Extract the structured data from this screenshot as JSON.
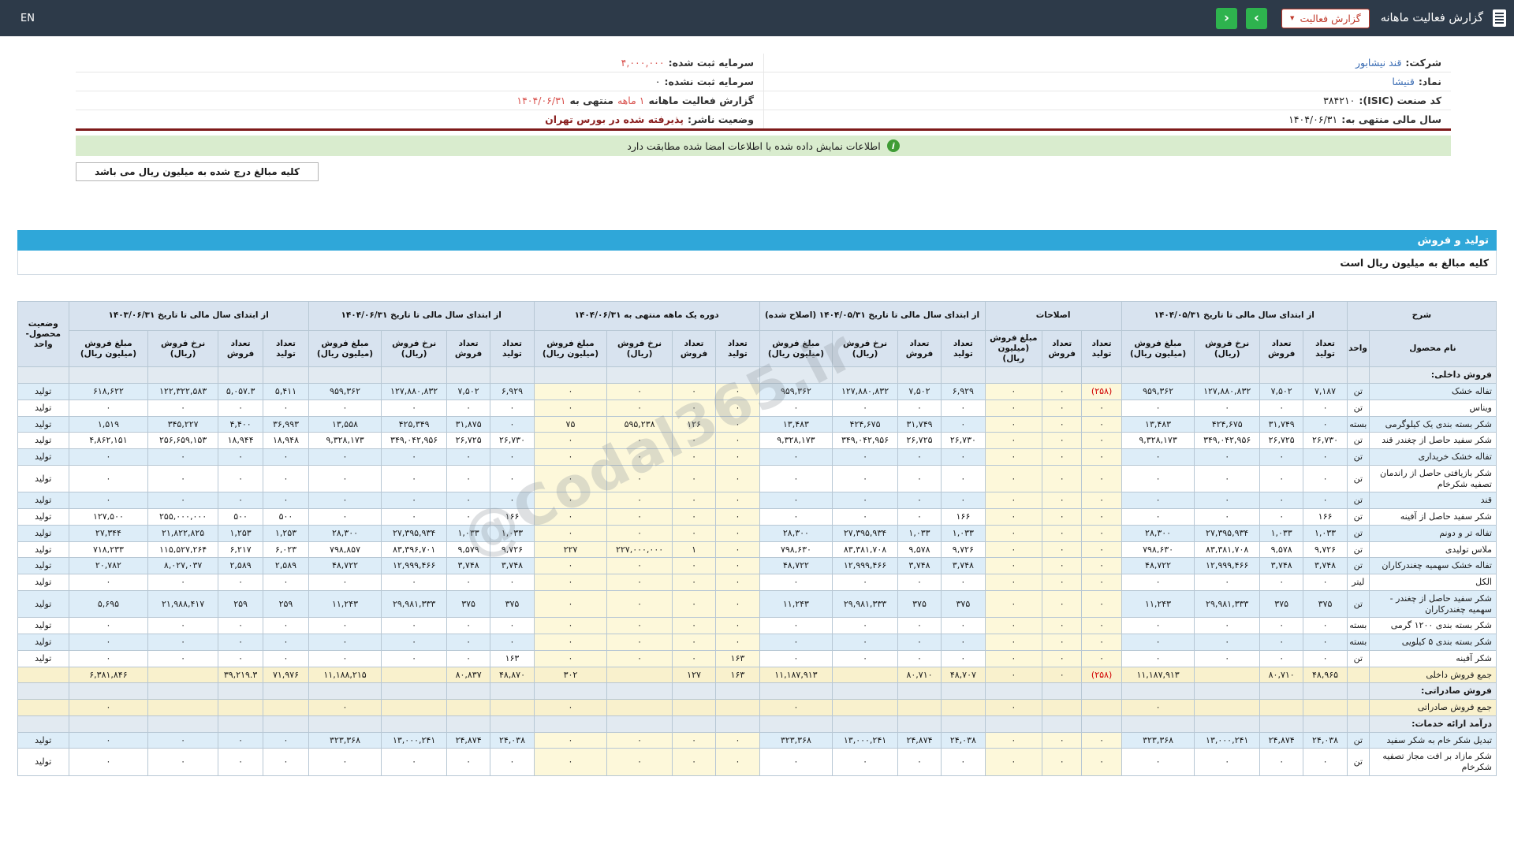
{
  "topbar": {
    "title": "گزارش فعالیت ماهانه",
    "report_button": {
      "label": "گزارش فعالیت",
      "caret": "▼"
    },
    "nav": {
      "forward": "›",
      "back": "‹"
    },
    "lang": "EN"
  },
  "company_info": {
    "right": [
      {
        "parts": [
          {
            "t": "شرکت:",
            "s": "label"
          },
          {
            "t": "قند نیشابور",
            "s": "link"
          }
        ]
      },
      {
        "parts": [
          {
            "t": "نماد:",
            "s": "label"
          },
          {
            "t": "قنیشا",
            "s": "link"
          }
        ]
      },
      {
        "parts": [
          {
            "t": "کد صنعت (ISIC):",
            "s": "label"
          },
          {
            "t": "۳۸۴۲۱۰",
            "s": "plain"
          }
        ]
      },
      {
        "parts": [
          {
            "t": "سال مالی منتهی به:",
            "s": "label"
          },
          {
            "t": "۱۴۰۴/۰۶/۳۱",
            "s": "plain"
          }
        ]
      }
    ],
    "left": [
      {
        "parts": [
          {
            "t": "سرمایه ثبت شده:",
            "s": "label"
          },
          {
            "t": "۴,۰۰۰,۰۰۰",
            "s": "red"
          }
        ]
      },
      {
        "parts": [
          {
            "t": "سرمایه ثبت نشده:",
            "s": "label"
          },
          {
            "t": "۰",
            "s": "plain"
          }
        ]
      },
      {
        "parts": [
          {
            "t": "گزارش فعالیت ماهانه",
            "s": "label"
          },
          {
            "t": "۱ ماهه",
            "s": "red"
          },
          {
            "t": "منتهی به",
            "s": "label"
          },
          {
            "t": "۱۴۰۴/۰۶/۳۱",
            "s": "red"
          }
        ]
      },
      {
        "parts": [
          {
            "t": "وضعیت ناشر:",
            "s": "label"
          },
          {
            "t": "پذیرفته شده در بورس تهران",
            "s": "darkred"
          }
        ]
      }
    ]
  },
  "notice": {
    "text": "اطلاعات نمایش داده شده با اطلاعات امضا شده مطابقت دارد",
    "icon": "i"
  },
  "amounts_note": "کلیه مبالغ درج شده به میلیون ریال می باشد",
  "section_bar": "تولید و فروش",
  "table_note": "کلیه مبالغ به میلیون ریال است",
  "watermark": "@Codal365.ir",
  "table": {
    "columns": {
      "desc": "شرح",
      "name": "نام محصول",
      "unit": "واحد",
      "qty_prod": "تعداد تولید",
      "qty_sale": "تعداد فروش",
      "rate": "نرخ فروش (ریال)",
      "amount": "مبلغ فروش (میلیون ریال)",
      "status_l1": "وضعیت",
      "status_l2": "محصول-واحد"
    },
    "groups": [
      {
        "label": "از ابتدای سال مالی تا تاریخ ۱۴۰۴/۰۵/۳۱",
        "cols": [
          "qty_prod",
          "qty_sale",
          "rate",
          "amount"
        ],
        "hl": false
      },
      {
        "label": "اصلاحات",
        "cols": [
          "qty_prod",
          "qty_sale",
          "amount"
        ],
        "hl": true
      },
      {
        "label": "از ابتدای سال مالی تا تاریخ ۱۴۰۴/۰۵/۳۱ (اصلاح شده)",
        "cols": [
          "qty_prod",
          "qty_sale",
          "rate",
          "amount"
        ],
        "hl": false
      },
      {
        "label": "دوره یک ماهه منتهی به ۱۴۰۴/۰۶/۳۱",
        "cols": [
          "qty_prod",
          "qty_sale",
          "rate",
          "amount"
        ],
        "hl": true
      },
      {
        "label": "از ابتدای سال مالی تا تاریخ ۱۴۰۴/۰۶/۳۱",
        "cols": [
          "qty_prod",
          "qty_sale",
          "rate",
          "amount"
        ],
        "hl": false
      },
      {
        "label": "از ابتدای سال مالی تا تاریخ ۱۴۰۳/۰۶/۳۱",
        "cols": [
          "qty_prod",
          "qty_sale",
          "rate",
          "amount"
        ],
        "hl": false
      }
    ],
    "rows": [
      {
        "type": "section",
        "name": "فروش داخلی:"
      },
      {
        "type": "product",
        "name": "تفاله خشک",
        "unit": "تن",
        "status": "تولید",
        "v": [
          [
            "۷,۱۸۷",
            "۷,۵۰۲",
            "۱۲۷,۸۸۰,۸۳۲",
            "۹۵۹,۳۶۲"
          ],
          [
            "(۲۵۸)",
            "۰",
            "۰"
          ],
          [
            "۶,۹۲۹",
            "۷,۵۰۲",
            "۱۲۷,۸۸۰,۸۳۲",
            "۹۵۹,۳۶۲"
          ],
          [
            "۰",
            "۰",
            "۰",
            "۰"
          ],
          [
            "۶,۹۲۹",
            "۷,۵۰۲",
            "۱۲۷,۸۸۰,۸۳۲",
            "۹۵۹,۳۶۲"
          ],
          [
            "۵,۴۱۱",
            "۵,۰۵۷.۳",
            "۱۲۲,۳۲۲,۵۸۳",
            "۶۱۸,۶۲۲"
          ]
        ]
      },
      {
        "type": "product",
        "name": "ویناس",
        "unit": "تن",
        "status": "تولید",
        "v": [
          [
            "۰",
            "۰",
            "۰",
            "۰"
          ],
          [
            "۰",
            "۰",
            "۰"
          ],
          [
            "۰",
            "۰",
            "۰",
            "۰"
          ],
          [
            "۰",
            "۰",
            "۰",
            "۰"
          ],
          [
            "۰",
            "۰",
            "۰",
            "۰"
          ],
          [
            "۰",
            "۰",
            "۰",
            "۰"
          ]
        ]
      },
      {
        "type": "product",
        "name": "شکر بسته بندی یک کیلوگرمی",
        "unit": "بسته",
        "status": "تولید",
        "v": [
          [
            "۰",
            "۳۱,۷۴۹",
            "۴۲۴,۶۷۵",
            "۱۳,۴۸۳"
          ],
          [
            "۰",
            "۰",
            "۰"
          ],
          [
            "۰",
            "۳۱,۷۴۹",
            "۴۲۴,۶۷۵",
            "۱۳,۴۸۳"
          ],
          [
            "۰",
            "۱۲۶",
            "۵۹۵,۲۳۸",
            "۷۵"
          ],
          [
            "۰",
            "۳۱,۸۷۵",
            "۴۲۵,۳۴۹",
            "۱۳,۵۵۸"
          ],
          [
            "۳۶,۹۹۳",
            "۴,۴۰۰",
            "۳۴۵,۲۲۷",
            "۱,۵۱۹"
          ]
        ]
      },
      {
        "type": "product",
        "name": "شکر سفید حاصل از چغندر قند",
        "unit": "تن",
        "status": "تولید",
        "v": [
          [
            "۲۶,۷۳۰",
            "۲۶,۷۲۵",
            "۳۴۹,۰۴۲,۹۵۶",
            "۹,۳۲۸,۱۷۳"
          ],
          [
            "۰",
            "۰",
            "۰"
          ],
          [
            "۲۶,۷۳۰",
            "۲۶,۷۲۵",
            "۳۴۹,۰۴۲,۹۵۶",
            "۹,۳۲۸,۱۷۳"
          ],
          [
            "۰",
            "۰",
            "۰",
            "۰"
          ],
          [
            "۲۶,۷۳۰",
            "۲۶,۷۲۵",
            "۳۴۹,۰۴۲,۹۵۶",
            "۹,۳۲۸,۱۷۳"
          ],
          [
            "۱۸,۹۴۸",
            "۱۸,۹۴۴",
            "۲۵۶,۶۵۹,۱۵۳",
            "۴,۸۶۲,۱۵۱"
          ]
        ]
      },
      {
        "type": "product",
        "name": "تفاله خشک خریداری",
        "unit": "تن",
        "status": "تولید",
        "v": [
          [
            "۰",
            "۰",
            "۰",
            "۰"
          ],
          [
            "۰",
            "۰",
            "۰"
          ],
          [
            "۰",
            "۰",
            "۰",
            "۰"
          ],
          [
            "۰",
            "۰",
            "۰",
            "۰"
          ],
          [
            "۰",
            "۰",
            "۰",
            "۰"
          ],
          [
            "۰",
            "۰",
            "۰",
            "۰"
          ]
        ]
      },
      {
        "type": "product",
        "name": "شکر بازیافتی حاصل از راندمان تصفیه شکرخام",
        "unit": "تن",
        "status": "تولید",
        "v": [
          [
            "۰",
            "۰",
            "۰",
            "۰"
          ],
          [
            "۰",
            "۰",
            "۰"
          ],
          [
            "۰",
            "۰",
            "۰",
            "۰"
          ],
          [
            "۰",
            "۰",
            "۰",
            "۰"
          ],
          [
            "۰",
            "۰",
            "۰",
            "۰"
          ],
          [
            "۰",
            "۰",
            "۰",
            "۰"
          ]
        ]
      },
      {
        "type": "product",
        "name": "قند",
        "unit": "تن",
        "status": "تولید",
        "v": [
          [
            "۰",
            "۰",
            "۰",
            "۰"
          ],
          [
            "۰",
            "۰",
            "۰"
          ],
          [
            "۰",
            "۰",
            "۰",
            "۰"
          ],
          [
            "۰",
            "۰",
            "۰",
            "۰"
          ],
          [
            "۰",
            "۰",
            "۰",
            "۰"
          ],
          [
            "۰",
            "۰",
            "۰",
            "۰"
          ]
        ]
      },
      {
        "type": "product",
        "name": "شکر سفید حاصل از آفینه",
        "unit": "تن",
        "status": "تولید",
        "v": [
          [
            "۱۶۶",
            "۰",
            "۰",
            "۰"
          ],
          [
            "۰",
            "۰",
            "۰"
          ],
          [
            "۱۶۶",
            "۰",
            "۰",
            "۰"
          ],
          [
            "۰",
            "۰",
            "۰",
            "۰"
          ],
          [
            "۱۶۶",
            "۰",
            "۰",
            "۰"
          ],
          [
            "۵۰۰",
            "۵۰۰",
            "۲۵۵,۰۰۰,۰۰۰",
            "۱۲۷,۵۰۰"
          ]
        ]
      },
      {
        "type": "product",
        "name": "تفاله تر و دونم",
        "unit": "تن",
        "status": "تولید",
        "v": [
          [
            "۱,۰۳۳",
            "۱,۰۳۳",
            "۲۷,۳۹۵,۹۳۴",
            "۲۸,۳۰۰"
          ],
          [
            "۰",
            "۰",
            "۰"
          ],
          [
            "۱,۰۳۳",
            "۱,۰۳۳",
            "۲۷,۳۹۵,۹۳۴",
            "۲۸,۳۰۰"
          ],
          [
            "۰",
            "۰",
            "۰",
            "۰"
          ],
          [
            "۱,۰۳۳",
            "۱,۰۳۳",
            "۲۷,۳۹۵,۹۳۴",
            "۲۸,۳۰۰"
          ],
          [
            "۱,۲۵۳",
            "۱,۲۵۳",
            "۲۱,۸۲۲,۸۲۵",
            "۲۷,۳۴۴"
          ]
        ]
      },
      {
        "type": "product",
        "name": "ملاس تولیدی",
        "unit": "تن",
        "status": "تولید",
        "v": [
          [
            "۹,۷۲۶",
            "۹,۵۷۸",
            "۸۳,۳۸۱,۷۰۸",
            "۷۹۸,۶۳۰"
          ],
          [
            "۰",
            "۰",
            "۰"
          ],
          [
            "۹,۷۲۶",
            "۹,۵۷۸",
            "۸۳,۳۸۱,۷۰۸",
            "۷۹۸,۶۳۰"
          ],
          [
            "۰",
            "۱",
            "۲۲۷,۰۰۰,۰۰۰",
            "۲۲۷"
          ],
          [
            "۹,۷۲۶",
            "۹,۵۷۹",
            "۸۳,۳۹۶,۷۰۱",
            "۷۹۸,۸۵۷"
          ],
          [
            "۶,۰۲۳",
            "۶,۲۱۷",
            "۱۱۵,۵۲۷,۲۶۴",
            "۷۱۸,۲۳۳"
          ]
        ]
      },
      {
        "type": "product",
        "name": "تفاله خشک سهمیه چغندرکاران",
        "unit": "تن",
        "status": "تولید",
        "v": [
          [
            "۳,۷۴۸",
            "۳,۷۴۸",
            "۱۲,۹۹۹,۴۶۶",
            "۴۸,۷۲۲"
          ],
          [
            "۰",
            "۰",
            "۰"
          ],
          [
            "۳,۷۴۸",
            "۳,۷۴۸",
            "۱۲,۹۹۹,۴۶۶",
            "۴۸,۷۲۲"
          ],
          [
            "۰",
            "۰",
            "۰",
            "۰"
          ],
          [
            "۳,۷۴۸",
            "۳,۷۴۸",
            "۱۲,۹۹۹,۴۶۶",
            "۴۸,۷۲۲"
          ],
          [
            "۲,۵۸۹",
            "۲,۵۸۹",
            "۸,۰۲۷,۰۳۷",
            "۲۰,۷۸۲"
          ]
        ]
      },
      {
        "type": "product",
        "name": "الکل",
        "unit": "لیتر",
        "status": "تولید",
        "v": [
          [
            "۰",
            "۰",
            "۰",
            "۰"
          ],
          [
            "۰",
            "۰",
            "۰"
          ],
          [
            "۰",
            "۰",
            "۰",
            "۰"
          ],
          [
            "۰",
            "۰",
            "۰",
            "۰"
          ],
          [
            "۰",
            "۰",
            "۰",
            "۰"
          ],
          [
            "۰",
            "۰",
            "۰",
            "۰"
          ]
        ]
      },
      {
        "type": "product",
        "name": "شکر سفید حاصل از چغندر - سهمیه چغندرکاران",
        "unit": "تن",
        "status": "تولید",
        "v": [
          [
            "۳۷۵",
            "۳۷۵",
            "۲۹,۹۸۱,۳۳۳",
            "۱۱,۲۴۳"
          ],
          [
            "۰",
            "۰",
            "۰"
          ],
          [
            "۳۷۵",
            "۳۷۵",
            "۲۹,۹۸۱,۳۳۳",
            "۱۱,۲۴۳"
          ],
          [
            "۰",
            "۰",
            "۰",
            "۰"
          ],
          [
            "۳۷۵",
            "۳۷۵",
            "۲۹,۹۸۱,۳۳۳",
            "۱۱,۲۴۳"
          ],
          [
            "۲۵۹",
            "۲۵۹",
            "۲۱,۹۸۸,۴۱۷",
            "۵,۶۹۵"
          ]
        ]
      },
      {
        "type": "product",
        "name": "شکر بسته بندی ۱۲۰۰ گرمی",
        "unit": "بسته",
        "status": "تولید",
        "v": [
          [
            "۰",
            "۰",
            "۰",
            "۰"
          ],
          [
            "۰",
            "۰",
            "۰"
          ],
          [
            "۰",
            "۰",
            "۰",
            "۰"
          ],
          [
            "۰",
            "۰",
            "۰",
            "۰"
          ],
          [
            "۰",
            "۰",
            "۰",
            "۰"
          ],
          [
            "۰",
            "۰",
            "۰",
            "۰"
          ]
        ]
      },
      {
        "type": "product",
        "name": "شکر بسته بندی ۵ کیلویی",
        "unit": "بسته",
        "status": "تولید",
        "v": [
          [
            "۰",
            "۰",
            "۰",
            "۰"
          ],
          [
            "۰",
            "۰",
            "۰"
          ],
          [
            "۰",
            "۰",
            "۰",
            "۰"
          ],
          [
            "۰",
            "۰",
            "۰",
            "۰"
          ],
          [
            "۰",
            "۰",
            "۰",
            "۰"
          ],
          [
            "۰",
            "۰",
            "۰",
            "۰"
          ]
        ]
      },
      {
        "type": "product",
        "name": "شکر آفینه",
        "unit": "تن",
        "status": "تولید",
        "v": [
          [
            "۰",
            "۰",
            "۰",
            "۰"
          ],
          [
            "۰",
            "۰",
            "۰"
          ],
          [
            "۰",
            "۰",
            "۰",
            "۰"
          ],
          [
            "۱۶۳",
            "۰",
            "۰",
            "۰"
          ],
          [
            "۱۶۳",
            "۰",
            "۰",
            "۰"
          ],
          [
            "۰",
            "۰",
            "۰",
            "۰"
          ]
        ]
      },
      {
        "type": "total",
        "name": "جمع فروش داخلی",
        "unit": "",
        "status": "",
        "v": [
          [
            "۴۸,۹۶۵",
            "۸۰,۷۱۰",
            "",
            "۱۱,۱۸۷,۹۱۳"
          ],
          [
            "(۲۵۸)",
            "۰",
            "۰"
          ],
          [
            "۴۸,۷۰۷",
            "۸۰,۷۱۰",
            "",
            "۱۱,۱۸۷,۹۱۳"
          ],
          [
            "۱۶۳",
            "۱۲۷",
            "",
            "۳۰۲"
          ],
          [
            "۴۸,۸۷۰",
            "۸۰,۸۳۷",
            "",
            "۱۱,۱۸۸,۲۱۵"
          ],
          [
            "۷۱,۹۷۶",
            "۳۹,۲۱۹.۳",
            "",
            "۶,۳۸۱,۸۴۶"
          ]
        ]
      },
      {
        "type": "section",
        "name": "فروش صادراتی:"
      },
      {
        "type": "total",
        "name": "جمع فروش صادراتی",
        "unit": "",
        "status": "",
        "v": [
          [
            "",
            "",
            "",
            "۰"
          ],
          [
            "",
            "",
            "۰"
          ],
          [
            "",
            "",
            "",
            "۰"
          ],
          [
            "",
            "",
            "",
            "۰"
          ],
          [
            "",
            "",
            "",
            "۰"
          ],
          [
            "",
            "",
            "",
            "۰"
          ]
        ]
      },
      {
        "type": "section",
        "name": "درآمد ارائه خدمات:"
      },
      {
        "type": "product",
        "name": "تبدیل شکر خام به شکر سفید",
        "unit": "تن",
        "status": "تولید",
        "v": [
          [
            "۲۴,۰۳۸",
            "۲۴,۸۷۴",
            "۱۳,۰۰۰,۲۴۱",
            "۳۲۳,۳۶۸"
          ],
          [
            "۰",
            "۰",
            "۰"
          ],
          [
            "۲۴,۰۳۸",
            "۲۴,۸۷۴",
            "۱۳,۰۰۰,۲۴۱",
            "۳۲۳,۳۶۸"
          ],
          [
            "۰",
            "۰",
            "۰",
            "۰"
          ],
          [
            "۲۴,۰۳۸",
            "۲۴,۸۷۴",
            "۱۳,۰۰۰,۲۴۱",
            "۳۲۳,۳۶۸"
          ],
          [
            "۰",
            "۰",
            "۰",
            "۰"
          ]
        ]
      },
      {
        "type": "product",
        "name": "شکر مازاد بر افت مجاز تصفیه شکرخام",
        "unit": "تن",
        "status": "تولید",
        "v": [
          [
            "۰",
            "۰",
            "۰",
            "۰"
          ],
          [
            "۰",
            "۰",
            "۰"
          ],
          [
            "۰",
            "۰",
            "۰",
            "۰"
          ],
          [
            "۰",
            "۰",
            "۰",
            "۰"
          ],
          [
            "۰",
            "۰",
            "۰",
            "۰"
          ],
          [
            "۰",
            "۰",
            "۰",
            "۰"
          ]
        ]
      }
    ]
  }
}
